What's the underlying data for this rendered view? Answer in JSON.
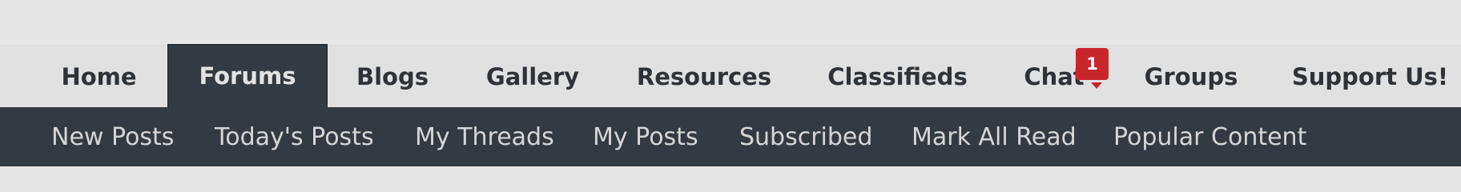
{
  "main_nav": {
    "tabs": [
      {
        "label": "Home"
      },
      {
        "label": "Forums"
      },
      {
        "label": "Blogs"
      },
      {
        "label": "Gallery"
      },
      {
        "label": "Resources"
      },
      {
        "label": "Classifieds"
      },
      {
        "label": "Chat"
      },
      {
        "label": "Groups"
      },
      {
        "label": "Support Us!"
      }
    ],
    "selected": "Forums",
    "chat_badge": "1"
  },
  "sub_nav": {
    "items": [
      {
        "label": "New Posts"
      },
      {
        "label": "Today's Posts"
      },
      {
        "label": "My Threads"
      },
      {
        "label": "My Posts"
      },
      {
        "label": "Subscribed"
      },
      {
        "label": "Mark All Read"
      },
      {
        "label": "Popular Content"
      }
    ]
  },
  "colors": {
    "nav_background": "#e1e1e1",
    "selected_tab": "#343a41",
    "subnav_background": "#343a41",
    "badge": "#c9262c"
  }
}
